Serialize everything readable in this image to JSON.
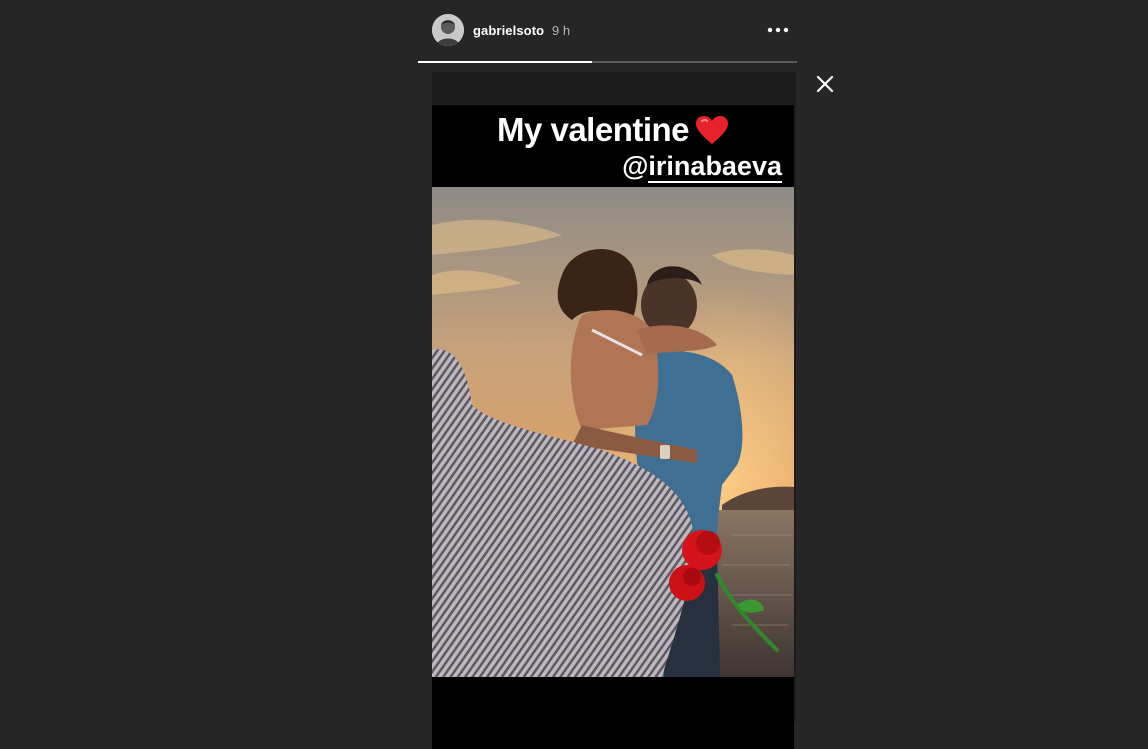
{
  "story": {
    "username": "gabrielsoto",
    "timestamp": "9 h",
    "progress": 0.46,
    "caption": {
      "title": "My valentine",
      "mention_prefix": "@",
      "mention_handle": "irinabaeva"
    }
  },
  "icons": {
    "more": "more-horizontal-icon",
    "close": "close-icon",
    "heart": "red-heart-emoji",
    "rose": "red-rose-sticker"
  },
  "colors": {
    "background": "#262626",
    "text": "#ffffff",
    "muted": "#b3b3b3",
    "progress_track": "#5a5a5a",
    "progress_fill": "#ffffff"
  }
}
